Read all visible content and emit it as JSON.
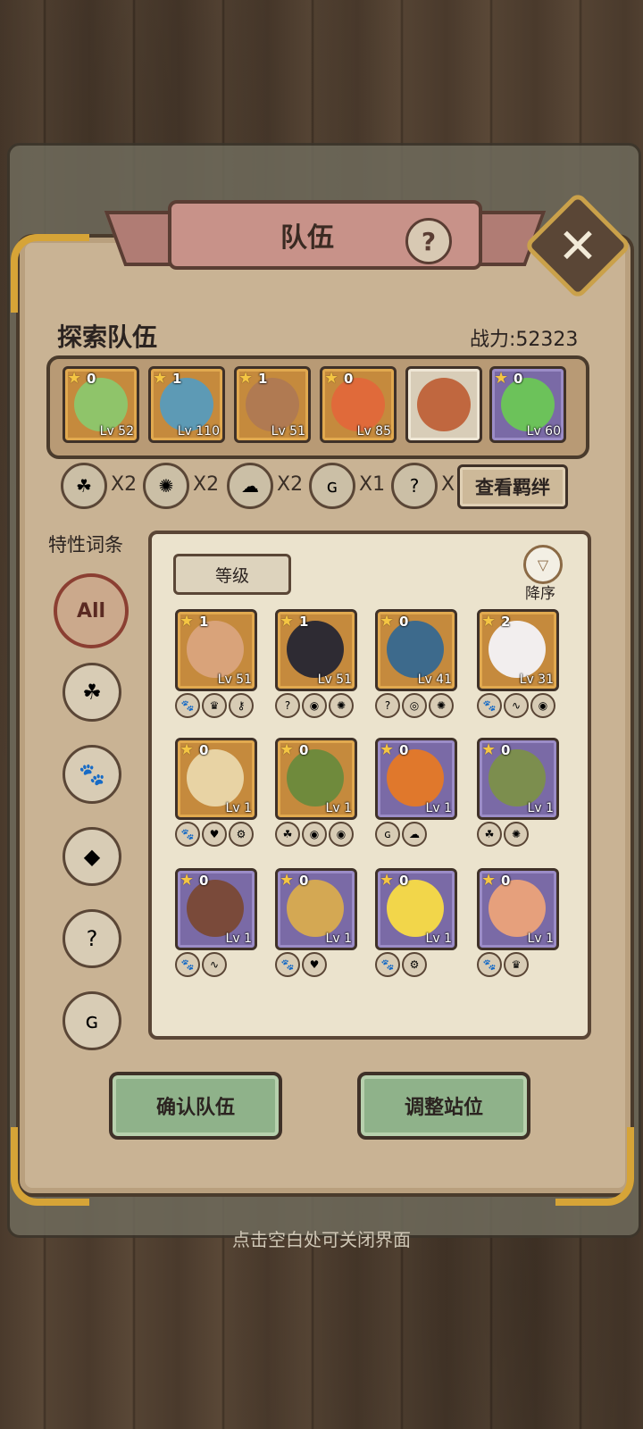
{
  "window": {
    "title": "队伍",
    "help_glyph": "?",
    "close_glyph": "✕",
    "close_hint": "点击空白处可关闭界面"
  },
  "team": {
    "title": "探索队伍",
    "power_label": "战力:52323",
    "slots": [
      {
        "stars": "0",
        "level": "Lv 52",
        "frame": "gold",
        "face_color": "#8fc46a"
      },
      {
        "stars": "1",
        "level": "Lv 110",
        "frame": "gold",
        "face_color": "#5d9ab5"
      },
      {
        "stars": "1",
        "level": "Lv 51",
        "frame": "gold",
        "face_color": "#b07a52"
      },
      {
        "stars": "0",
        "level": "Lv 85",
        "frame": "gold",
        "face_color": "#e06a3a"
      },
      {
        "stars": "",
        "level": "",
        "frame": "plain",
        "face_color": "#c0673f"
      },
      {
        "stars": "0",
        "level": "Lv 60",
        "frame": "purple",
        "face_color": "#6cc25a"
      }
    ]
  },
  "bonds": {
    "items": [
      {
        "icon": "leaf-icon",
        "glyph": "☘",
        "count": "X2"
      },
      {
        "icon": "swirl-icon",
        "glyph": "✺",
        "count": "X2"
      },
      {
        "icon": "ghost-icon",
        "glyph": "☁",
        "count": "X2"
      },
      {
        "icon": "spiral-icon",
        "glyph": "ɢ",
        "count": "X1"
      },
      {
        "icon": "question-icon",
        "glyph": "?",
        "count": "X"
      }
    ],
    "view_button": "查看羁绊"
  },
  "traits": {
    "title": "特性词条",
    "filters": [
      {
        "name": "all",
        "glyph": "All"
      },
      {
        "name": "leaf",
        "glyph": "☘"
      },
      {
        "name": "paw",
        "glyph": "🐾"
      },
      {
        "name": "crystal",
        "glyph": "◆"
      },
      {
        "name": "question",
        "glyph": "?"
      },
      {
        "name": "spiral",
        "glyph": "ɢ"
      }
    ]
  },
  "roster": {
    "sort_label": "等级",
    "order_label": "降序",
    "order_glyph": "▽",
    "cards": [
      {
        "stars": "1",
        "level": "Lv 51",
        "frame": "gold",
        "face_color": "#d9a37a",
        "traits": [
          "🐾",
          "♛",
          "⚷"
        ]
      },
      {
        "stars": "1",
        "level": "Lv 51",
        "frame": "gold",
        "face_color": "#2e2b33",
        "traits": [
          "?",
          "◉",
          "✺"
        ]
      },
      {
        "stars": "0",
        "level": "Lv 41",
        "frame": "gold",
        "face_color": "#3d6a8c",
        "traits": [
          "?",
          "◎",
          "✺"
        ]
      },
      {
        "stars": "2",
        "level": "Lv 31",
        "frame": "gold",
        "face_color": "#f2eeee",
        "traits": [
          "🐾",
          "∿",
          "◉"
        ]
      },
      {
        "stars": "0",
        "level": "Lv 1",
        "frame": "gold",
        "face_color": "#e8d3a4",
        "traits": [
          "🐾",
          "♥",
          "⚙"
        ]
      },
      {
        "stars": "0",
        "level": "Lv 1",
        "frame": "gold",
        "face_color": "#6f8a3c",
        "traits": [
          "☘",
          "◉",
          "◉"
        ]
      },
      {
        "stars": "0",
        "level": "Lv 1",
        "frame": "purple",
        "face_color": "#e0782c",
        "traits": [
          "ɢ",
          "☁"
        ]
      },
      {
        "stars": "0",
        "level": "Lv 1",
        "frame": "purple",
        "face_color": "#7c8e4e",
        "traits": [
          "☘",
          "✺"
        ]
      },
      {
        "stars": "0",
        "level": "Lv 1",
        "frame": "purple",
        "face_color": "#7a4a3a",
        "traits": [
          "🐾",
          "∿"
        ]
      },
      {
        "stars": "0",
        "level": "Lv 1",
        "frame": "purple",
        "face_color": "#d4a853",
        "traits": [
          "🐾",
          "♥"
        ]
      },
      {
        "stars": "0",
        "level": "Lv 1",
        "frame": "purple",
        "face_color": "#f2d64a",
        "traits": [
          "🐾",
          "⚙"
        ]
      },
      {
        "stars": "0",
        "level": "Lv 1",
        "frame": "purple",
        "face_color": "#e6a07c",
        "traits": [
          "🐾",
          "♛"
        ]
      }
    ]
  },
  "actions": {
    "confirm": "确认队伍",
    "adjust": "调整站位"
  }
}
